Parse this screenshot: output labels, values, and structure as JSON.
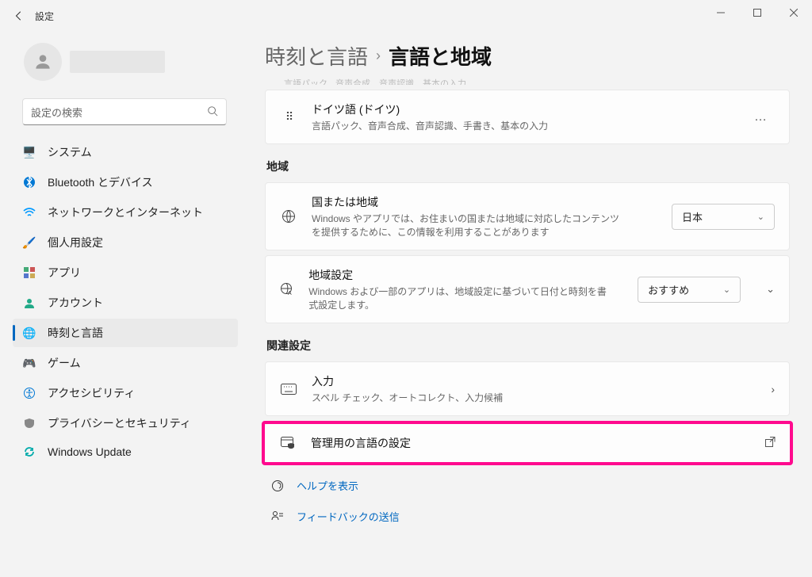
{
  "window": {
    "title": "設定"
  },
  "search": {
    "placeholder": "設定の検索"
  },
  "nav": {
    "system": "システム",
    "bluetooth": "Bluetooth とデバイス",
    "network": "ネットワークとインターネット",
    "personalization": "個人用設定",
    "apps": "アプリ",
    "accounts": "アカウント",
    "time_language": "時刻と言語",
    "gaming": "ゲーム",
    "accessibility": "アクセシビリティ",
    "privacy": "プライバシーとセキュリティ",
    "update": "Windows Update"
  },
  "breadcrumb": {
    "parent": "時刻と言語",
    "current": "言語と地域"
  },
  "truncated_row": "言語パック、音声合成、音声認識、基本の入力",
  "german_card": {
    "title": "ドイツ語 (ドイツ)",
    "desc": "言語パック、音声合成、音声認識、手書き、基本の入力",
    "more": "…"
  },
  "section_region": "地域",
  "region_card": {
    "title": "国または地域",
    "desc": "Windows やアプリでは、お住まいの国または地域に対応したコンテンツを提供するために、この情報を利用することがあります",
    "value": "日本"
  },
  "locale_card": {
    "title": "地域設定",
    "desc": "Windows および一部のアプリは、地域設定に基づいて日付と時刻を書式設定します。",
    "value": "おすすめ"
  },
  "section_related": "関連設定",
  "input_card": {
    "title": "入力",
    "desc": "スペル チェック、オートコレクト、入力候補"
  },
  "admin_card": {
    "title": "管理用の言語の設定"
  },
  "links": {
    "help": "ヘルプを表示",
    "feedback": "フィードバックの送信"
  }
}
